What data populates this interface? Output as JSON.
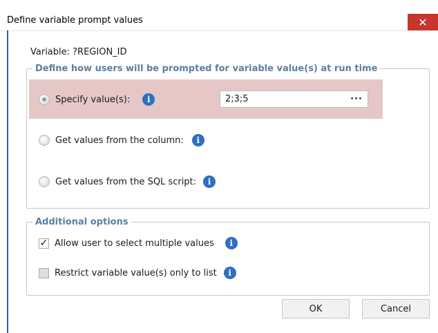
{
  "window": {
    "title": "Define variable prompt values",
    "close_glyph": "✕"
  },
  "variable": {
    "label": "Variable:",
    "name": "?REGION_ID"
  },
  "prompt_group": {
    "legend": "Define how users will be prompted for variable value(s) at run time",
    "options": [
      {
        "label": "Specify value(s):",
        "selected": true
      },
      {
        "label": "Get values from the column:",
        "selected": false
      },
      {
        "label": "Get values from the SQL script:",
        "selected": false
      }
    ],
    "value": "2;3;5",
    "browse_label": "···"
  },
  "additional_group": {
    "legend": "Additional options",
    "options": [
      {
        "label": "Allow user to select multiple values",
        "checked": true
      },
      {
        "label": "Restrict variable value(s) only to list",
        "checked": false
      }
    ]
  },
  "buttons": {
    "ok": "OK",
    "cancel": "Cancel"
  },
  "info_glyph": "i",
  "check_glyph": "✓",
  "colors": {
    "close": "#c7362c",
    "info": "#2d6fc3",
    "highlight": "#e6c7c7",
    "legend": "#5d7fa2"
  }
}
